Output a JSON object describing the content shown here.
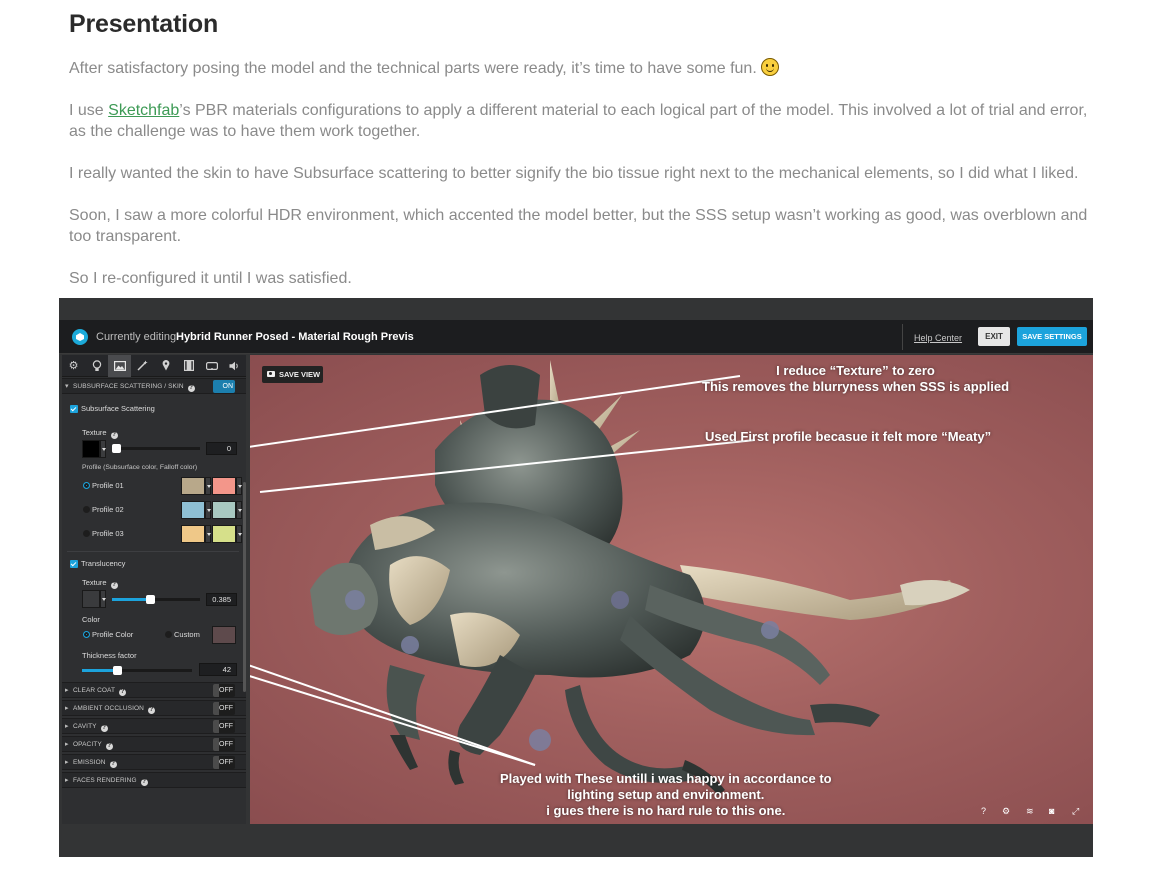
{
  "article": {
    "heading": "Presentation",
    "p1_text": "After satisfactory posing the model and the technical parts were ready, it’s time to have some fun.",
    "p2_link": "Sketchfab",
    "p2_line1_rest": "’s PBR materials configurations to apply a different material to each logical part of the model. This involved a lot of trial and error,",
    "p2_prefix": "I use ",
    "p2_line2": "as the challenge was to have them work together.",
    "p3_text": "I really wanted the skin to have Subsurface scattering to better signify the bio tissue right next to the mechanical elements, so I did what I liked.",
    "p4_line1": "Soon, I saw a more colorful HDR environment, which accented the model better, but the SSS setup wasn’t working as good, was overblown and",
    "p4_line2": "too transparent.",
    "p5_text": "So I re-configured it until I was satisfied."
  },
  "editor": {
    "topbar": {
      "editing_label": "Currently editing",
      "model_name": "Hybrid Runner Posed - Material Rough Previs",
      "help": "Help Center",
      "exit": "EXIT",
      "save": "SAVE SETTINGS"
    },
    "tools": [
      "gear-icon",
      "lightbulb-icon",
      "image-icon",
      "wand-icon",
      "pin-icon",
      "film-icon",
      "vr-icon",
      "speaker-icon"
    ],
    "sss_section": {
      "title": "SUBSURFACE SCATTERING / SKIN",
      "toggle": "ON",
      "sss_label": "Subsurface Scattering",
      "texture_label": "Texture",
      "texture_value": "0",
      "texture_slider": 0.0,
      "profile_label": "Profile (Subsurface color, Falloff color)",
      "profiles": [
        {
          "label": "Profile 01",
          "selected": true,
          "color_a": "#b8a88a",
          "color_b": "#f3968a"
        },
        {
          "label": "Profile 02",
          "selected": false,
          "color_a": "#8fc0d4",
          "color_b": "#a8c8c0"
        },
        {
          "label": "Profile 03",
          "selected": false,
          "color_a": "#efc888",
          "color_b": "#d6e08a"
        }
      ],
      "translucency_label": "Translucency",
      "tr_texture_label": "Texture",
      "tr_texture_value": "0.385",
      "tr_texture_slider": 0.385,
      "color_label": "Color",
      "color_opt1": "Profile Color",
      "color_opt2": "Custom",
      "custom_color": "#5e4a4c",
      "thickness_label": "Thickness factor",
      "thickness_value": "42",
      "thickness_slider": 0.28
    },
    "collapsed_sections": [
      {
        "title": "CLEAR COAT",
        "toggle": "OFF"
      },
      {
        "title": "AMBIENT OCCLUSION",
        "toggle": "OFF"
      },
      {
        "title": "CAVITY",
        "toggle": "OFF"
      },
      {
        "title": "OPACITY",
        "toggle": "OFF"
      },
      {
        "title": "EMISSION",
        "toggle": "OFF"
      },
      {
        "title": "FACES RENDERING",
        "toggle": ""
      }
    ],
    "viewport": {
      "save_view": "SAVE VIEW",
      "annotation_1_line1": "I reduce “Texture” to zero",
      "annotation_1_line2": "This removes the blurryness when SSS is applied",
      "annotation_2": "Used First profile becasue it felt more “Meaty”",
      "annotation_3_line1": "Played with These untill i was happy in accordance to",
      "annotation_3_line2": "lighting setup and environment.",
      "annotation_3_line3": "i gues there is no hard rule to this one.",
      "bottom_icons": [
        "help-icon",
        "gear-icon",
        "layers-icon",
        "vr-icon",
        "fullscreen-icon"
      ],
      "bottom_icon_glyphs": [
        "?",
        "⚙",
        "≋",
        "◙",
        "⤢"
      ]
    }
  }
}
